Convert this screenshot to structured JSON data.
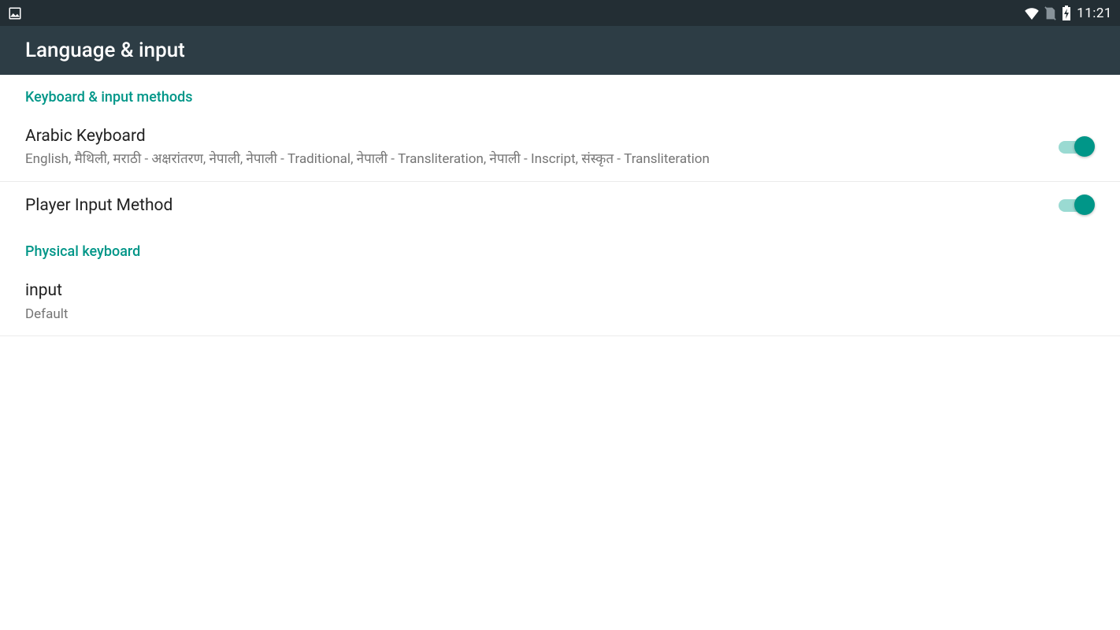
{
  "statusBar": {
    "time": "11:21"
  },
  "appBar": {
    "title": "Language & input"
  },
  "sections": {
    "keyboardInputMethods": {
      "header": "Keyboard & input methods",
      "items": {
        "arabicKeyboard": {
          "title": "Arabic Keyboard",
          "subtitle": "English, मैथिली, मराठी - अक्षरांतरण, नेपाली, नेपाली - Traditional, नेपाली - Transliteration, नेपाली - Inscript, संस्कृत - Transliteration",
          "switch": true
        },
        "playerInputMethod": {
          "title": "Player Input Method",
          "switch": true
        }
      }
    },
    "physicalKeyboard": {
      "header": "Physical keyboard",
      "items": {
        "input": {
          "title": "input",
          "subtitle": "Default"
        }
      }
    }
  }
}
